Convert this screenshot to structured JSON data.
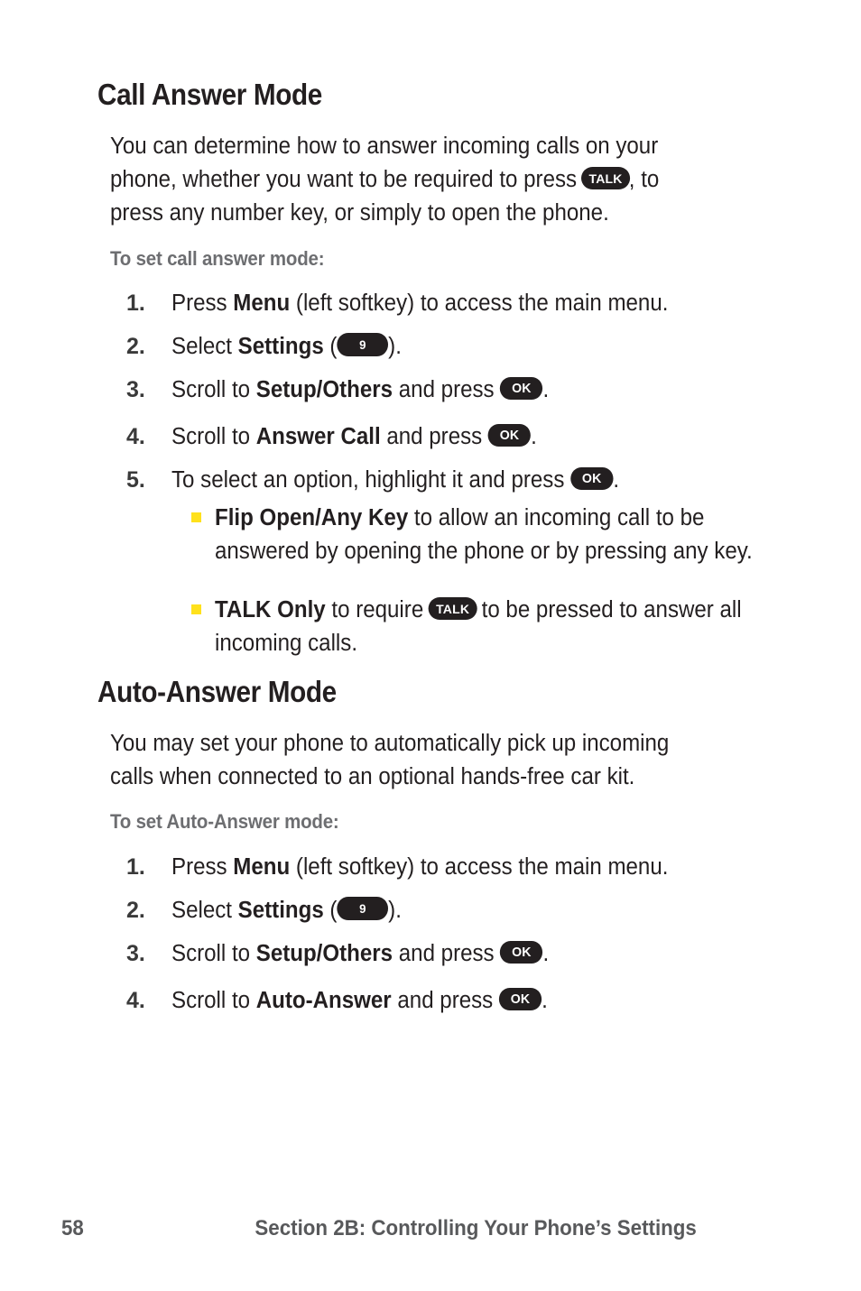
{
  "page": {
    "background": "#ffffff",
    "text_color": "#231f20",
    "bullet_color": "#ffe11c",
    "key_badge_color": "#231f20",
    "subheading_color": "#6d6e71",
    "footer_color": "#58595b"
  },
  "sections": [
    {
      "heading": "Call Answer Mode",
      "intro_before_key": "You can determine how to answer incoming calls on your phone, whether you want to be required to press ",
      "intro_key": "TALK",
      "intro_after_key": ", to press any number key, or simply to open the phone.",
      "subheading": "To set call answer mode:",
      "steps": [
        {
          "number": "1.",
          "before_bold": "Press ",
          "bold": "Menu",
          "after_bold": " (left softkey) to access the main menu."
        },
        {
          "number": "2.",
          "before_bold": "Select ",
          "bold": "Settings",
          "after_bold_open": " (",
          "key": "9",
          "after_key": ")."
        },
        {
          "number": "3.",
          "before_bold": "Scroll to ",
          "bold": "Setup/Others",
          "after_bold": " and press ",
          "key": "OK",
          "after_key": "."
        },
        {
          "number": "4.",
          "before_bold": "Scroll to ",
          "bold": "Answer Call",
          "after_bold": " and press ",
          "key": "OK",
          "after_key": "."
        },
        {
          "number": "5.",
          "before_bold": "To select an option, highlight it and press ",
          "bold": "",
          "after_bold": "",
          "key": "OK",
          "after_key": "."
        }
      ],
      "bullets": [
        {
          "bold": "Flip Open/Any Key",
          "text": " to allow an incoming call to be answered by opening the phone or by pressing any key."
        },
        {
          "bold": "TALK Only",
          "before_key": " to require ",
          "key": "TALK",
          "after_key": " to be pressed to answer all incoming calls."
        }
      ]
    },
    {
      "heading": "Auto-Answer Mode",
      "intro": "You may set your phone to automatically pick up incoming calls when connected to an optional hands-free car kit.",
      "subheading": "To set Auto-Answer mode:",
      "steps": [
        {
          "number": "1.",
          "before_bold": "Press ",
          "bold": "Menu",
          "after_bold": " (left softkey) to access the main menu."
        },
        {
          "number": "2.",
          "before_bold": "Select ",
          "bold": "Settings",
          "after_bold_open": " (",
          "key": "9",
          "after_key": ")."
        },
        {
          "number": "3.",
          "before_bold": "Scroll to ",
          "bold": "Setup/Others",
          "after_bold": " and press ",
          "key": "OK",
          "after_key": "."
        },
        {
          "number": "4.",
          "before_bold": "Scroll to ",
          "bold": "Auto-Answer",
          "after_bold": " and press ",
          "key": "OK",
          "after_key": "."
        }
      ]
    }
  ],
  "footer": {
    "page_number": "58",
    "section_title": "Section 2B: Controlling Your Phone’s Settings"
  }
}
